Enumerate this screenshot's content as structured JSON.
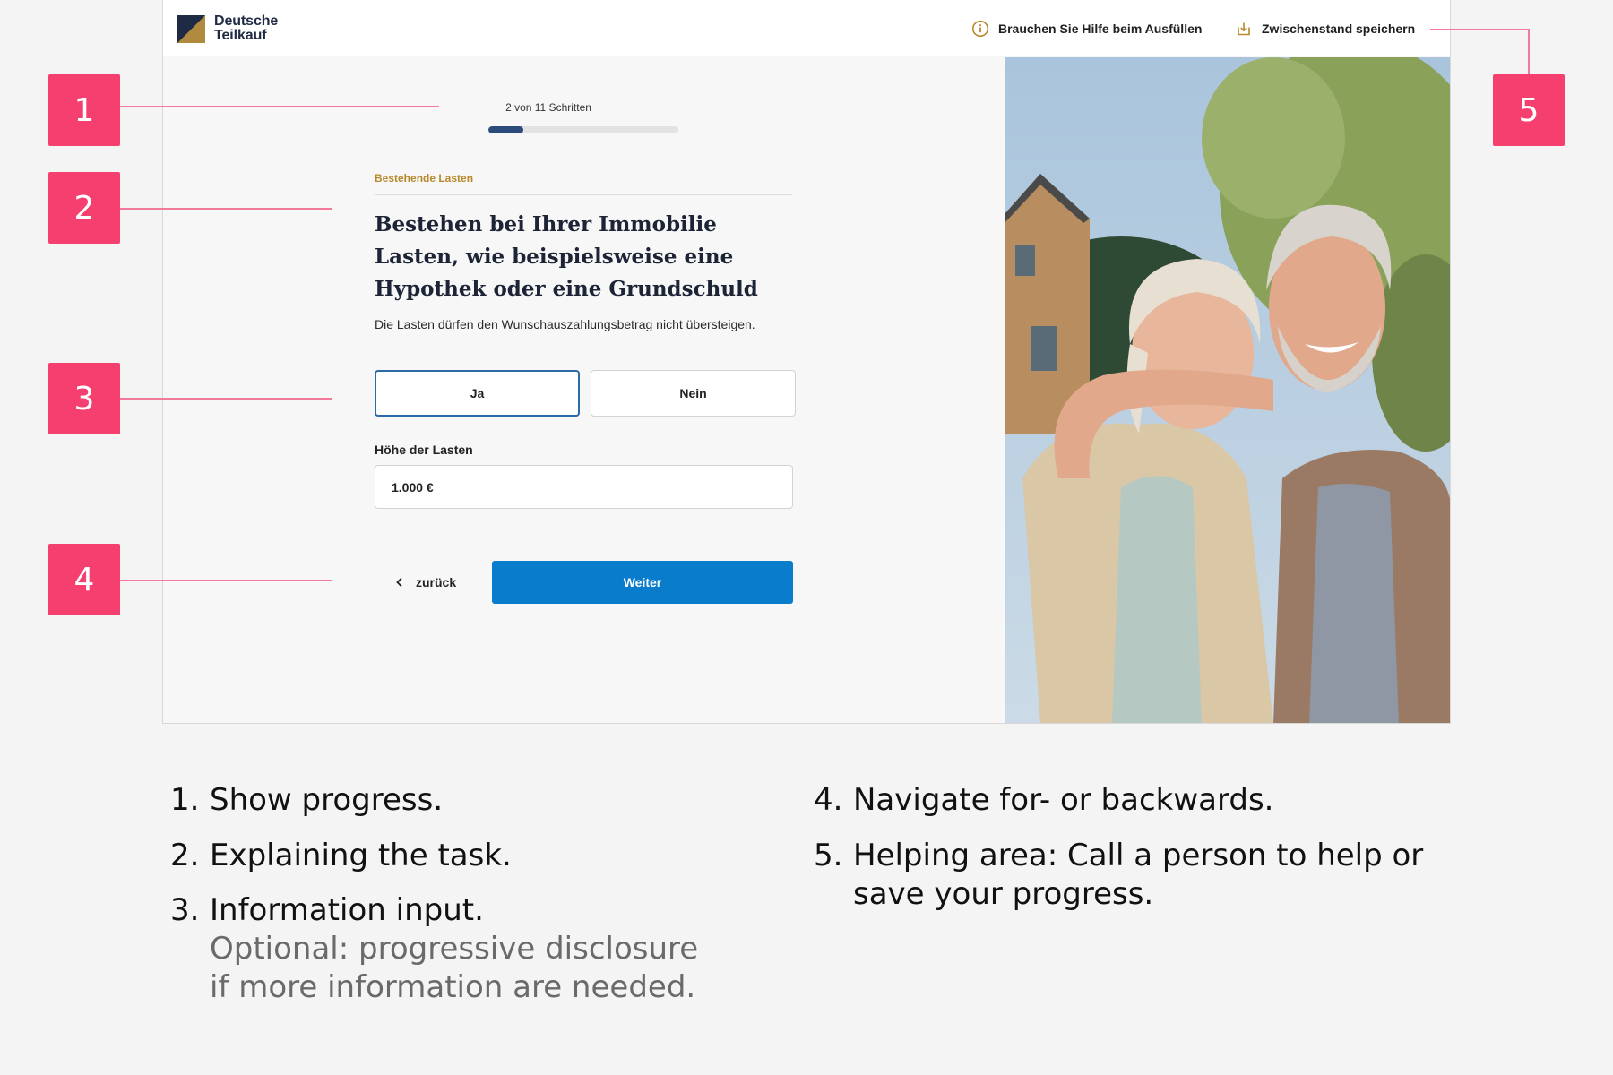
{
  "header": {
    "brand_line1": "Deutsche",
    "brand_line2": "Teilkauf",
    "help_label": "Brauchen Sie Hilfe beim Ausfüllen",
    "save_label": "Zwischenstand speichern",
    "help_icon": "info-circle-icon",
    "save_icon": "download-tray-icon"
  },
  "progress": {
    "label": "2 von 11 Schritten",
    "current": 2,
    "total": 11
  },
  "form": {
    "section": "Bestehende Lasten",
    "question": "Bestehen bei Ihrer Immobilie Lasten, wie beispielsweise eine Hypothek oder eine Grundschuld",
    "hint": "Die Lasten dürfen den Wunschauszahlungsbetrag nicht übersteigen.",
    "options": [
      "Ja",
      "Nein"
    ],
    "selected_option": "Ja",
    "amount_label": "Höhe der Lasten",
    "amount_value": "1.000 €",
    "back_label": "zurück",
    "next_label": "Weiter"
  },
  "colors": {
    "accent": "#f43f6f",
    "primary_button": "#0a7ccc",
    "progress": "#2c4a7a",
    "section_label": "#b8892a"
  },
  "annotations": [
    "1",
    "2",
    "3",
    "4",
    "5"
  ],
  "legend": [
    {
      "num": "1.",
      "text": "Show progress."
    },
    {
      "num": "2.",
      "text": "Explaining the task."
    },
    {
      "num": "3.",
      "text": "Information input.",
      "sub1": "Optional: progressive disclosure",
      "sub2": "if more information are needed."
    },
    {
      "num": "4.",
      "text": "Navigate for- or backwards."
    },
    {
      "num": "5.",
      "text": "Helping area: Call a person to help or",
      "text2": "save your progress."
    }
  ]
}
